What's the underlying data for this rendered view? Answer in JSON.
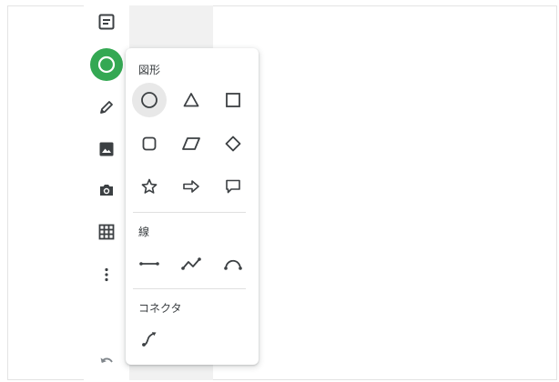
{
  "toolbar": {
    "tools": [
      {
        "icon": "text-box-icon"
      },
      {
        "icon": "shape-circle-icon",
        "active": true
      },
      {
        "icon": "pen-icon"
      },
      {
        "icon": "image-icon"
      },
      {
        "icon": "camera-icon"
      },
      {
        "icon": "grid-icon"
      },
      {
        "icon": "more-vert-icon"
      },
      {
        "icon": "undo-icon"
      }
    ],
    "active_color": "#34a853"
  },
  "shape_menu": {
    "shapes_title": "図形",
    "lines_title": "線",
    "connector_title": "コネクタ",
    "shapes": [
      "circle",
      "triangle",
      "square",
      "rounded-square",
      "parallelogram",
      "diamond",
      "star",
      "arrow",
      "speech-bubble"
    ],
    "selected_shape": "circle",
    "lines": [
      "straight-line",
      "polyline",
      "curve"
    ],
    "connectors": [
      "connector"
    ]
  }
}
